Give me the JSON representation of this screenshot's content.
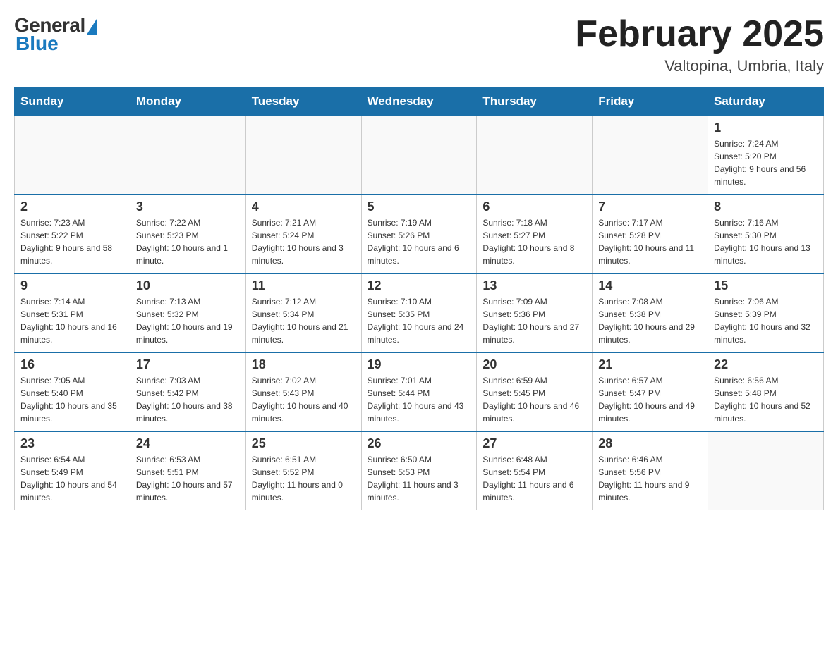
{
  "header": {
    "logo_general": "General",
    "logo_blue": "Blue",
    "month_title": "February 2025",
    "location": "Valtopina, Umbria, Italy"
  },
  "days_of_week": [
    "Sunday",
    "Monday",
    "Tuesday",
    "Wednesday",
    "Thursday",
    "Friday",
    "Saturday"
  ],
  "weeks": [
    [
      {
        "day": "",
        "info": ""
      },
      {
        "day": "",
        "info": ""
      },
      {
        "day": "",
        "info": ""
      },
      {
        "day": "",
        "info": ""
      },
      {
        "day": "",
        "info": ""
      },
      {
        "day": "",
        "info": ""
      },
      {
        "day": "1",
        "info": "Sunrise: 7:24 AM\nSunset: 5:20 PM\nDaylight: 9 hours and 56 minutes."
      }
    ],
    [
      {
        "day": "2",
        "info": "Sunrise: 7:23 AM\nSunset: 5:22 PM\nDaylight: 9 hours and 58 minutes."
      },
      {
        "day": "3",
        "info": "Sunrise: 7:22 AM\nSunset: 5:23 PM\nDaylight: 10 hours and 1 minute."
      },
      {
        "day": "4",
        "info": "Sunrise: 7:21 AM\nSunset: 5:24 PM\nDaylight: 10 hours and 3 minutes."
      },
      {
        "day": "5",
        "info": "Sunrise: 7:19 AM\nSunset: 5:26 PM\nDaylight: 10 hours and 6 minutes."
      },
      {
        "day": "6",
        "info": "Sunrise: 7:18 AM\nSunset: 5:27 PM\nDaylight: 10 hours and 8 minutes."
      },
      {
        "day": "7",
        "info": "Sunrise: 7:17 AM\nSunset: 5:28 PM\nDaylight: 10 hours and 11 minutes."
      },
      {
        "day": "8",
        "info": "Sunrise: 7:16 AM\nSunset: 5:30 PM\nDaylight: 10 hours and 13 minutes."
      }
    ],
    [
      {
        "day": "9",
        "info": "Sunrise: 7:14 AM\nSunset: 5:31 PM\nDaylight: 10 hours and 16 minutes."
      },
      {
        "day": "10",
        "info": "Sunrise: 7:13 AM\nSunset: 5:32 PM\nDaylight: 10 hours and 19 minutes."
      },
      {
        "day": "11",
        "info": "Sunrise: 7:12 AM\nSunset: 5:34 PM\nDaylight: 10 hours and 21 minutes."
      },
      {
        "day": "12",
        "info": "Sunrise: 7:10 AM\nSunset: 5:35 PM\nDaylight: 10 hours and 24 minutes."
      },
      {
        "day": "13",
        "info": "Sunrise: 7:09 AM\nSunset: 5:36 PM\nDaylight: 10 hours and 27 minutes."
      },
      {
        "day": "14",
        "info": "Sunrise: 7:08 AM\nSunset: 5:38 PM\nDaylight: 10 hours and 29 minutes."
      },
      {
        "day": "15",
        "info": "Sunrise: 7:06 AM\nSunset: 5:39 PM\nDaylight: 10 hours and 32 minutes."
      }
    ],
    [
      {
        "day": "16",
        "info": "Sunrise: 7:05 AM\nSunset: 5:40 PM\nDaylight: 10 hours and 35 minutes."
      },
      {
        "day": "17",
        "info": "Sunrise: 7:03 AM\nSunset: 5:42 PM\nDaylight: 10 hours and 38 minutes."
      },
      {
        "day": "18",
        "info": "Sunrise: 7:02 AM\nSunset: 5:43 PM\nDaylight: 10 hours and 40 minutes."
      },
      {
        "day": "19",
        "info": "Sunrise: 7:01 AM\nSunset: 5:44 PM\nDaylight: 10 hours and 43 minutes."
      },
      {
        "day": "20",
        "info": "Sunrise: 6:59 AM\nSunset: 5:45 PM\nDaylight: 10 hours and 46 minutes."
      },
      {
        "day": "21",
        "info": "Sunrise: 6:57 AM\nSunset: 5:47 PM\nDaylight: 10 hours and 49 minutes."
      },
      {
        "day": "22",
        "info": "Sunrise: 6:56 AM\nSunset: 5:48 PM\nDaylight: 10 hours and 52 minutes."
      }
    ],
    [
      {
        "day": "23",
        "info": "Sunrise: 6:54 AM\nSunset: 5:49 PM\nDaylight: 10 hours and 54 minutes."
      },
      {
        "day": "24",
        "info": "Sunrise: 6:53 AM\nSunset: 5:51 PM\nDaylight: 10 hours and 57 minutes."
      },
      {
        "day": "25",
        "info": "Sunrise: 6:51 AM\nSunset: 5:52 PM\nDaylight: 11 hours and 0 minutes."
      },
      {
        "day": "26",
        "info": "Sunrise: 6:50 AM\nSunset: 5:53 PM\nDaylight: 11 hours and 3 minutes."
      },
      {
        "day": "27",
        "info": "Sunrise: 6:48 AM\nSunset: 5:54 PM\nDaylight: 11 hours and 6 minutes."
      },
      {
        "day": "28",
        "info": "Sunrise: 6:46 AM\nSunset: 5:56 PM\nDaylight: 11 hours and 9 minutes."
      },
      {
        "day": "",
        "info": ""
      }
    ]
  ]
}
